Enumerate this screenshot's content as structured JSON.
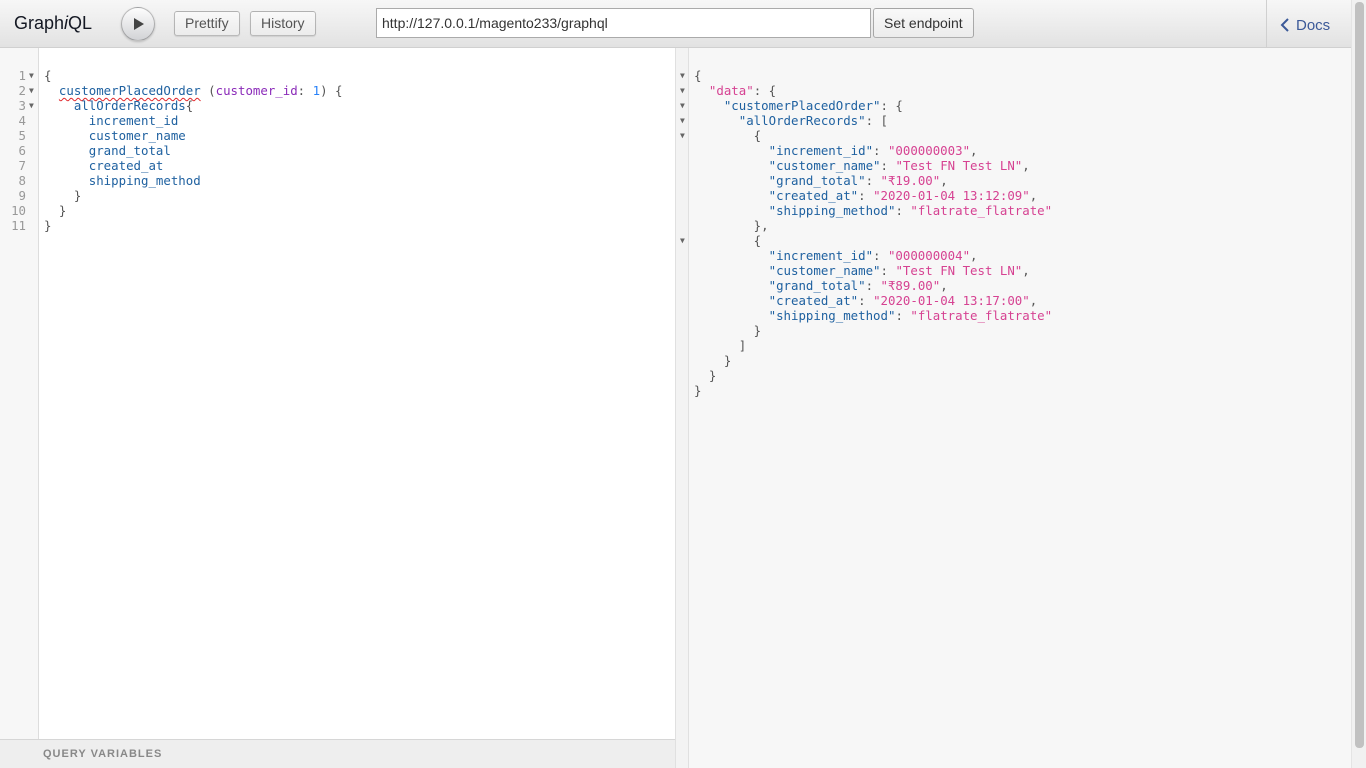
{
  "app": {
    "title_prefix": "Graph",
    "title_italic": "i",
    "title_suffix": "QL"
  },
  "toolbar": {
    "prettify_label": "Prettify",
    "history_label": "History",
    "endpoint_value": "http://127.0.0.1/magento233/graphql",
    "set_endpoint_label": "Set endpoint",
    "docs_label": "Docs"
  },
  "query_editor": {
    "line_numbers": [
      "1",
      "2",
      "3",
      "4",
      "5",
      "6",
      "7",
      "8",
      "9",
      "10",
      "11"
    ],
    "lines": [
      "{",
      "  customerPlacedOrder (customer_id: 1) {",
      "    allOrderRecords{",
      "      increment_id",
      "      customer_name",
      "      grand_total",
      "      created_at",
      "      shipping_method",
      "    }",
      "  }",
      "}"
    ],
    "root_field": "customerPlacedOrder",
    "arg_name": "customer_id",
    "arg_value": "1",
    "list_field": "allOrderRecords",
    "fields": [
      "increment_id",
      "customer_name",
      "grand_total",
      "created_at",
      "shipping_method"
    ]
  },
  "query_variables_label": "QUERY VARIABLES",
  "result": {
    "key_data": "\"data\"",
    "key_root": "\"customerPlacedOrder\"",
    "key_list": "\"allOrderRecords\"",
    "records": [
      {
        "increment_id": "\"000000003\"",
        "customer_name": "\"Test FN Test LN\"",
        "grand_total": "\"₹19.00\"",
        "created_at": "\"2020-01-04 13:12:09\"",
        "shipping_method": "\"flatrate_flatrate\""
      },
      {
        "increment_id": "\"000000004\"",
        "customer_name": "\"Test FN Test LN\"",
        "grand_total": "\"₹89.00\"",
        "created_at": "\"2020-01-04 13:17:00\"",
        "shipping_method": "\"flatrate_flatrate\""
      }
    ]
  },
  "colors": {
    "field": "#1f61a0",
    "argument": "#8b2bb9",
    "number": "#2882f9",
    "string": "#d64292",
    "docs_link": "#3b5998"
  },
  "icons": {
    "run": "play-icon",
    "docs": "chevron-left-icon",
    "fold": "fold-arrow-icon"
  }
}
